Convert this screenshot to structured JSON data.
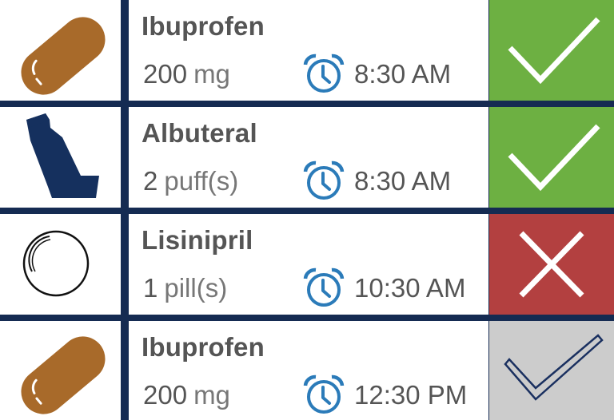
{
  "medications": [
    {
      "name": "Ibuprofen",
      "dose_amount": "200",
      "dose_unit": "mg",
      "time": "8:30 AM",
      "icon": "capsule-icon",
      "status": "taken",
      "status_icon": "checkmark-icon",
      "status_color": "#6db042"
    },
    {
      "name": "Albuteral",
      "dose_amount": "2",
      "dose_unit": "puff(s)",
      "time": "8:30 AM",
      "icon": "inhaler-icon",
      "status": "taken",
      "status_icon": "checkmark-icon",
      "status_color": "#6db042"
    },
    {
      "name": "Lisinipril",
      "dose_amount": "1",
      "dose_unit": "pill(s)",
      "time": "10:30 AM",
      "icon": "pill-icon",
      "status": "missed",
      "status_icon": "x-icon",
      "status_color": "#b34040"
    },
    {
      "name": "Ibuprofen",
      "dose_amount": "200",
      "dose_unit": "mg",
      "time": "12:30 PM",
      "icon": "capsule-icon",
      "status": "pending",
      "status_icon": "checkmark-outline-icon",
      "status_color": "#cccccc"
    }
  ],
  "colors": {
    "background": "#152b52",
    "capsule": "#a86a2a",
    "inhaler": "#15305e",
    "alarm": "#2b7bb9",
    "text": "#555555"
  }
}
